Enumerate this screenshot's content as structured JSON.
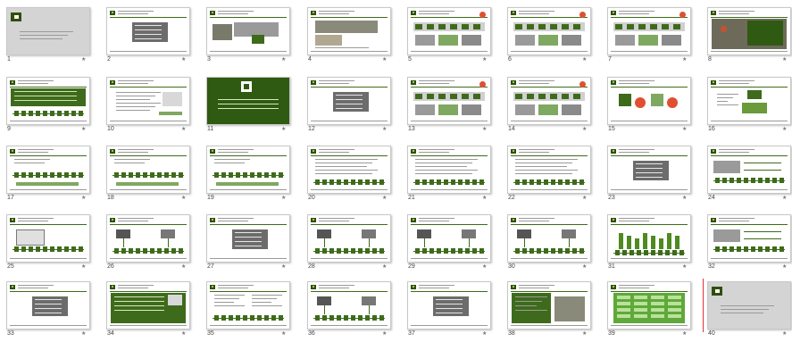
{
  "slides": [
    {
      "n": "1",
      "kind": "title-gray"
    },
    {
      "n": "2",
      "kind": "contents"
    },
    {
      "n": "3",
      "kind": "photo-rack"
    },
    {
      "n": "4",
      "kind": "photo-rack2"
    },
    {
      "n": "5",
      "kind": "diagram-red"
    },
    {
      "n": "6",
      "kind": "diagram-red"
    },
    {
      "n": "7",
      "kind": "diagram-red"
    },
    {
      "n": "8",
      "kind": "photo-dark"
    },
    {
      "n": "9",
      "kind": "green-text"
    },
    {
      "n": "10",
      "kind": "bullets"
    },
    {
      "n": "11",
      "kind": "green-full"
    },
    {
      "n": "12",
      "kind": "contents"
    },
    {
      "n": "13",
      "kind": "diagram-red"
    },
    {
      "n": "14",
      "kind": "diagram-red"
    },
    {
      "n": "15",
      "kind": "red-shapes"
    },
    {
      "n": "16",
      "kind": "green-boxes"
    },
    {
      "n": "17",
      "kind": "bus-line"
    },
    {
      "n": "18",
      "kind": "bus-line"
    },
    {
      "n": "19",
      "kind": "bus-line"
    },
    {
      "n": "20",
      "kind": "bullets-bus"
    },
    {
      "n": "21",
      "kind": "bullets-bus"
    },
    {
      "n": "22",
      "kind": "bullets-bus"
    },
    {
      "n": "23",
      "kind": "contents"
    },
    {
      "n": "24",
      "kind": "diagram-lines"
    },
    {
      "n": "25",
      "kind": "diagram-box"
    },
    {
      "n": "26",
      "kind": "diagram-bus"
    },
    {
      "n": "27",
      "kind": "contents"
    },
    {
      "n": "28",
      "kind": "diagram-bus"
    },
    {
      "n": "29",
      "kind": "diagram-bus"
    },
    {
      "n": "30",
      "kind": "diagram-bus"
    },
    {
      "n": "31",
      "kind": "bars"
    },
    {
      "n": "32",
      "kind": "diagram-lines"
    },
    {
      "n": "33",
      "kind": "contents"
    },
    {
      "n": "34",
      "kind": "green-photo"
    },
    {
      "n": "35",
      "kind": "two-col"
    },
    {
      "n": "36",
      "kind": "diagram-bus"
    },
    {
      "n": "37",
      "kind": "contents"
    },
    {
      "n": "38",
      "kind": "green-photo2"
    },
    {
      "n": "39",
      "kind": "green-table"
    },
    {
      "n": "40",
      "kind": "title-gray"
    }
  ],
  "star_icon": "★"
}
